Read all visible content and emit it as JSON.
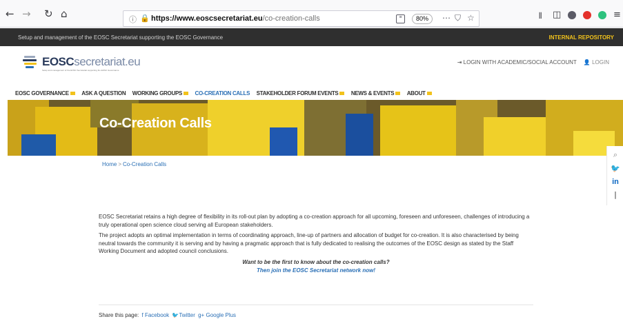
{
  "browser": {
    "url_host": "https://www.eoscsecretariat.eu",
    "url_path": "/co-creation-calls",
    "zoom": "80%",
    "icons": [
      "back-arrow",
      "forward-arrow",
      "reload",
      "home",
      "info",
      "lock",
      "reader-view",
      "more",
      "pocket",
      "star",
      "library",
      "sidebar",
      "account",
      "adblock",
      "extension",
      "menu"
    ]
  },
  "topbar": {
    "tagline": "Setup and management of the EOSC Secretariat supporting the EOSC Governance",
    "repo_link": "INTERNAL REPOSITORY"
  },
  "header": {
    "logo_bold": "EOSC",
    "logo_light": "secretariat.eu",
    "logo_sub": "Setup and management of the EOSC Secretariat supporting the EOSC Governance",
    "login_academic": "LOGIN WITH ACADEMIC/SOCIAL ACCOUNT",
    "login": "LOGIN"
  },
  "nav": {
    "items": [
      {
        "label": "EOSC GOVERNANCE",
        "flag": true
      },
      {
        "label": "ASK A QUESTION",
        "flag": false
      },
      {
        "label": "WORKING GROUPS",
        "flag": true
      },
      {
        "label": "CO-CREATION CALLS",
        "flag": false
      },
      {
        "label": "STAKEHOLDER FORUM EVENTS",
        "flag": true
      },
      {
        "label": "NEWS & EVENTS",
        "flag": true
      },
      {
        "label": "ABOUT",
        "flag": true
      }
    ]
  },
  "hero": {
    "title": "Co-Creation Calls"
  },
  "breadcrumb": {
    "home": "Home",
    "separator": ">",
    "current": "Co-Creation Calls"
  },
  "content": {
    "p1": "EOSC Secretariat retains a high degree of flexibility in its roll-out plan by adopting a co-creation approach for all upcoming, foreseen and unforeseen, challenges of introducing a truly operational open science cloud serving all European stakeholders.",
    "p2": "The project adopts an optimal implementation in terms of coordinating approach, line-up of partners and allocation of budget for co-creation. It is also characterised by being neutral towards the community it is serving and by having a pragmatic approach that is fully dedicated to realising the outcomes of the EOSC design as stated by the Staff Working Document and adopted council conclusions.",
    "cta_question": "Want to be the first to know about the co-creation calls?",
    "cta_action": "Then join the EOSC Secretariat network now!"
  },
  "share": {
    "label": "Share this page:",
    "facebook": "Facebook",
    "twitter": "Twitter",
    "google": "Google Plus"
  },
  "colors": {
    "accent": "#2a6fb5",
    "brand_yellow": "#f2c21b",
    "topbar_bg": "#2f2f2f"
  }
}
